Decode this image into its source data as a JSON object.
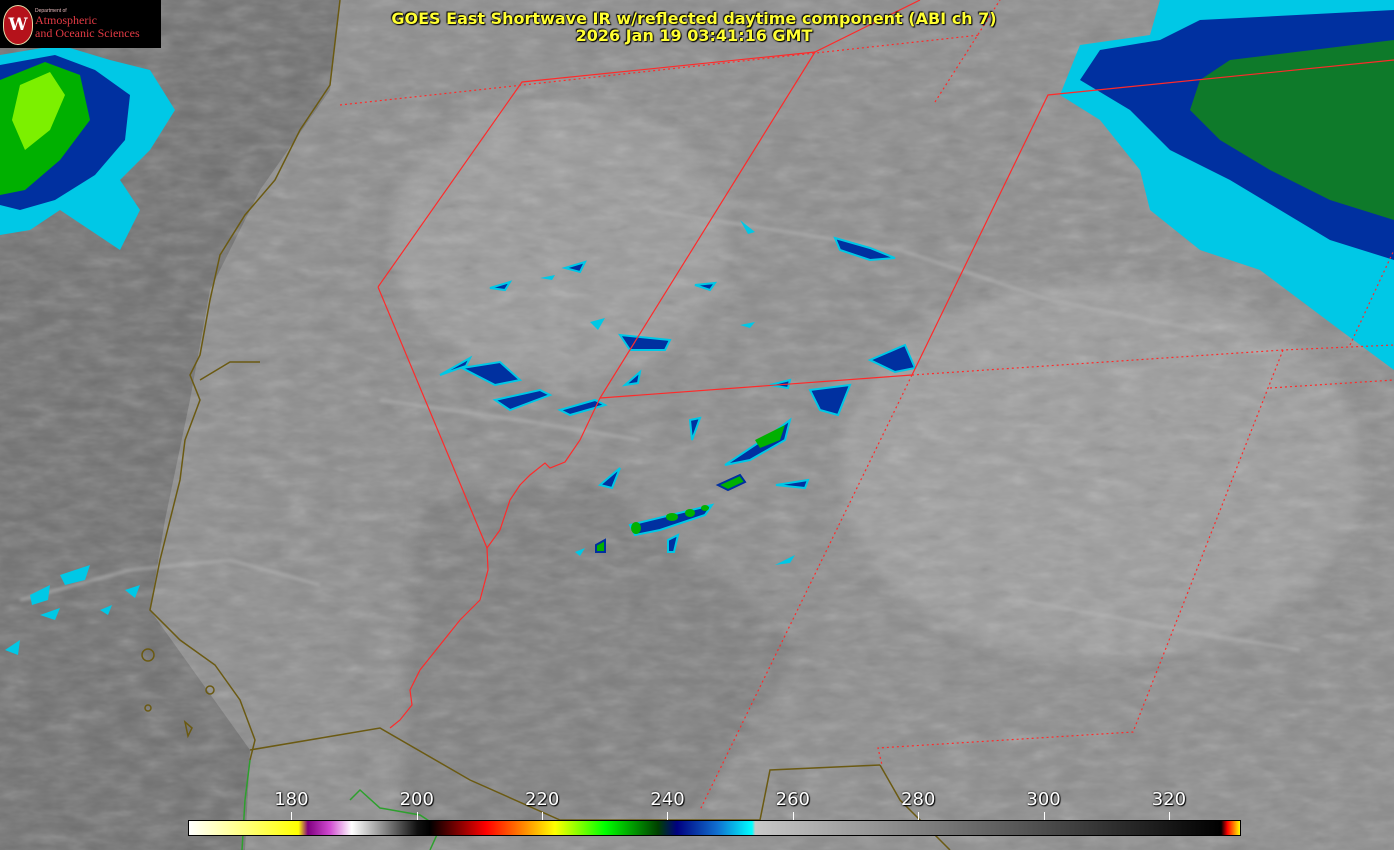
{
  "title": {
    "line1": "GOES East Shortwave IR w/reflected daytime component (ABI ch 7)",
    "line2": "2026 Jan 19 03:41:16 GMT"
  },
  "logo": {
    "seal_letter": "W",
    "department": "Department of",
    "line1": "Atmospheric",
    "line2": "and Oceanic Sciences"
  },
  "colorbar": {
    "min": 163.5,
    "max": 331.5,
    "ticks": [
      {
        "value": 180,
        "label": "180"
      },
      {
        "value": 200,
        "label": "200"
      },
      {
        "value": 220,
        "label": "220"
      },
      {
        "value": 240,
        "label": "240"
      },
      {
        "value": 260,
        "label": "260"
      },
      {
        "value": 280,
        "label": "280"
      },
      {
        "value": 300,
        "label": "300"
      },
      {
        "value": 320,
        "label": "320"
      }
    ],
    "color_stops": [
      {
        "value": 163.5,
        "color": "#ffffff"
      },
      {
        "value": 181.0,
        "color": "#ffff00"
      },
      {
        "value": 182.5,
        "color": "#800080"
      },
      {
        "value": 186.0,
        "color": "#d04ad0"
      },
      {
        "value": 189.5,
        "color": "#ffffff"
      },
      {
        "value": 200.0,
        "color": "#101010"
      },
      {
        "value": 202.0,
        "color": "#000000"
      },
      {
        "value": 211.0,
        "color": "#ff0000"
      },
      {
        "value": 217.0,
        "color": "#ff8800"
      },
      {
        "value": 222.0,
        "color": "#ffff00"
      },
      {
        "value": 230.0,
        "color": "#00ff00"
      },
      {
        "value": 238.5,
        "color": "#004000"
      },
      {
        "value": 241.5,
        "color": "#000080"
      },
      {
        "value": 248.0,
        "color": "#1070d0"
      },
      {
        "value": 253.5,
        "color": "#00ffff"
      },
      {
        "value": 254.0,
        "color": "#c8c8c8"
      },
      {
        "value": 328.5,
        "color": "#000000"
      },
      {
        "value": 329.5,
        "color": "#ff0000"
      },
      {
        "value": 331.5,
        "color": "#ffff00"
      }
    ]
  },
  "colors": {
    "state_border": "#ff2a2a",
    "coastline": "#6b5a12",
    "coastline_lower": "#2da02d",
    "title_text": "#ffff33",
    "cloud_cold": "#00b000",
    "cloud_mid": "#0030a0",
    "cloud_edge": "#00c8e6",
    "land_background": "#888888",
    "ocean_background": "#6e6e6e"
  }
}
